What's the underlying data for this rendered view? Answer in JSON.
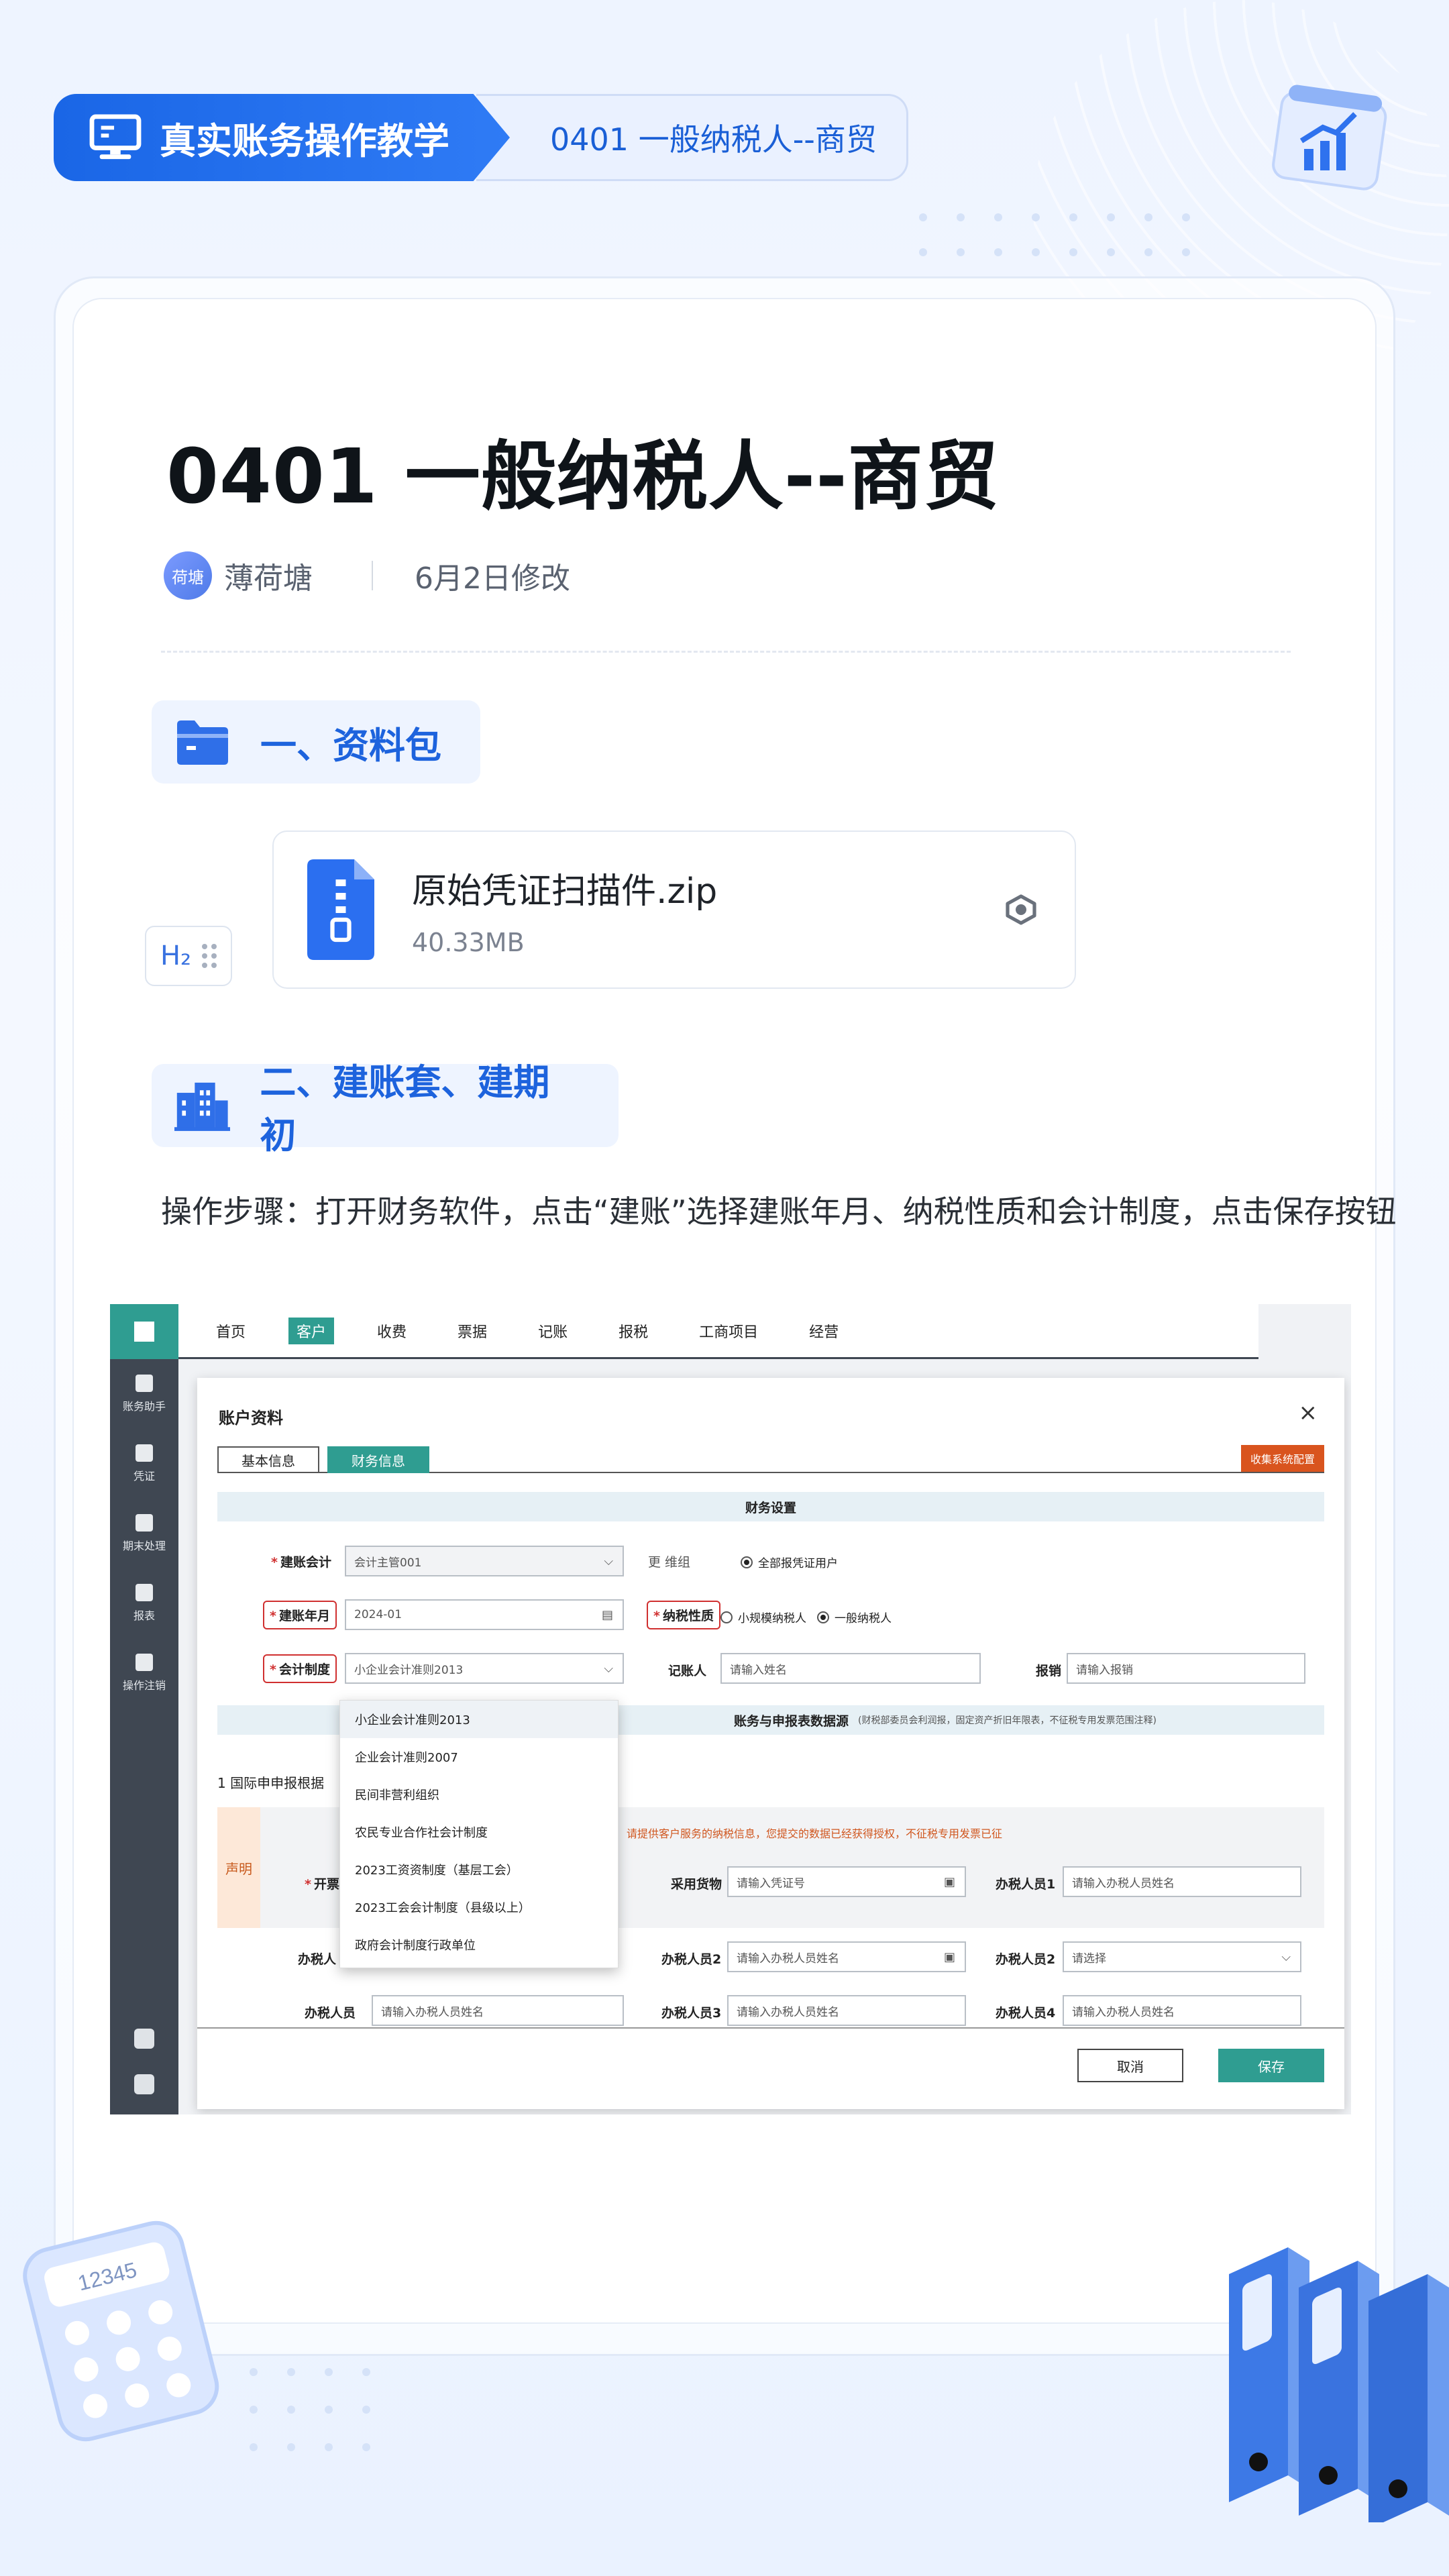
{
  "header": {
    "tag_title": "真实账务操作教学",
    "tag_subtitle": "0401 一般纳税人--商贸"
  },
  "article": {
    "title": "0401 一般纳税人--商贸",
    "author_avatar_text": "荷塘",
    "author": "薄荷塘",
    "modified": "6月2日修改",
    "section1_title": "一、资料包",
    "section2_title": "二、建账套、建期初",
    "h2_handle_label": "H₂",
    "file": {
      "name": "原始凭证扫描件.zip",
      "size": "40.33MB"
    },
    "steps": "操作步骤：打开财务软件，点击“建账”选择建账年月、纳税性质和会计制度，点击保存按钮"
  },
  "software": {
    "topnav": [
      "首页",
      "客户",
      "收费",
      "票据",
      "记账",
      "报税",
      "工商项目",
      "经营"
    ],
    "active_nav": "客户",
    "sidebar": [
      "账务助手",
      "凭证",
      "期末处理",
      "报表",
      "操作注销"
    ],
    "dialog": {
      "title": "账户资料",
      "tabs": [
        "基本信息",
        "财务信息"
      ],
      "sys_button": "收集系统配置",
      "band1": "财务设置",
      "band2": "账务与申报表数据源",
      "band2_note": "(财税部委员会利润报，固定资产折旧年限表，不征税专用发票范围注释)",
      "fields": {
        "account_label": "建账会计",
        "account_value": "会计主管001",
        "update_label": "更 维组",
        "all_tax_label": "全部报凭证用户",
        "year_label": "建账年月",
        "year_value": "2024-01",
        "tax_nature_label": "纳税性质",
        "tax_small": "小规模纳税人",
        "tax_general": "一般纳税人",
        "system_label": "会计制度",
        "system_value": "小企业会计准则2013",
        "bookkeeper_label": "记账人",
        "bookkeeper_placeholder": "请输入姓名",
        "reporter_label": "报销",
        "reporter_placeholder": "请输入报销",
        "section_row_label": "1 国际申申报根据",
        "notice_side": "声明",
        "notice_text": "请提供客户服务的纳税信息，您提交的数据已经获得授权，不征税专用发票已征",
        "issuer_label": "开票人",
        "adopt_label": "采用货物",
        "adopt_placeholder": "请输入凭证号",
        "tax_person1_label": "办税人员1",
        "tax_person1_placeholder": "请输入办税人员姓名",
        "tax_person_label": "办税人员",
        "tax_person2_label": "办税人员2",
        "tax_person2_placeholder": "请输入办税人员姓名",
        "tax_person2b_label": "办税人员2",
        "tax_person2b_placeholder": "请选择",
        "tax_person3_label": "办税人员3",
        "tax_person3_placeholder": "请输入办税人员姓名",
        "tax_person4_label": "办税人员4",
        "tax_person4_placeholder": "请输入办税人员姓名",
        "tax_person_left_label": "办税人",
        "tax_person_left_placeholder": "请输入办税人员姓名"
      },
      "dropdown_options": [
        "小企业会计准则2013",
        "企业会计准则2007",
        "民间非营利组织",
        "农民专业合作社会计制度",
        "2023工资资制度（基层工会）",
        "2023工会会计制度（县级以上）",
        "政府会计制度行政单位"
      ],
      "cancel": "取消",
      "save": "保存"
    }
  },
  "decor": {
    "calculator_display": "12345"
  },
  "colors": {
    "brand_blue": "#1a66e6",
    "teal": "#2f9d91",
    "orange": "#d9541e"
  }
}
